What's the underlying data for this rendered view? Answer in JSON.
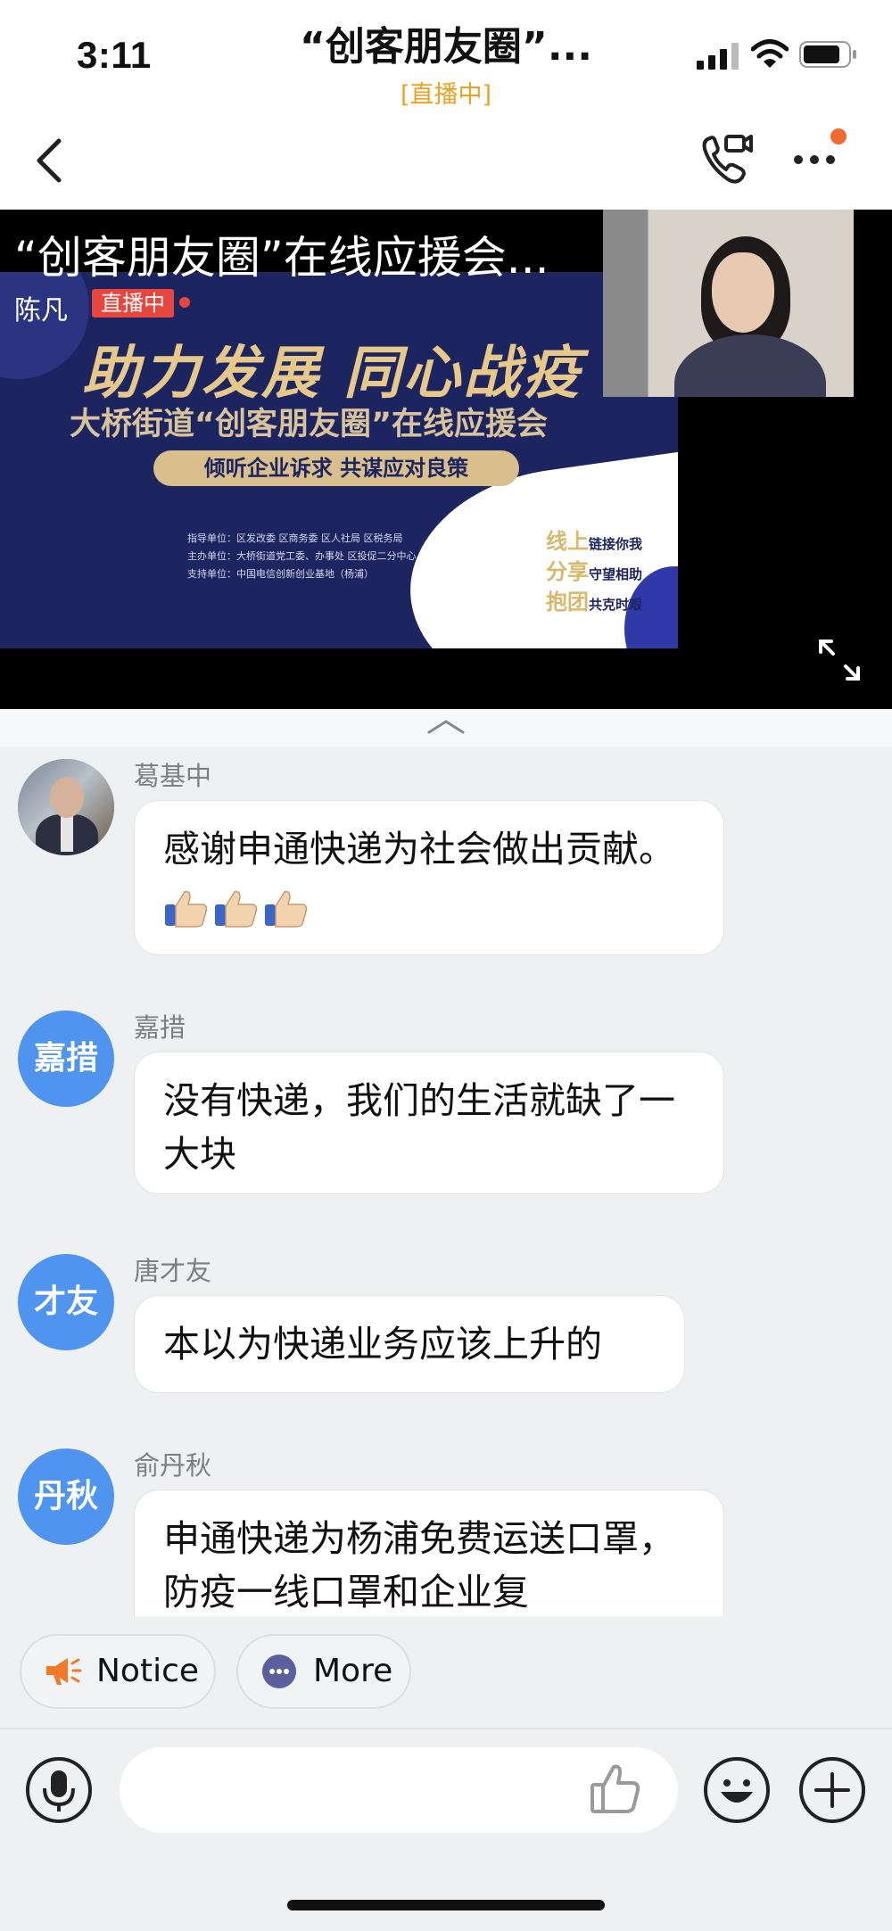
{
  "status": {
    "time": "3:11"
  },
  "header": {
    "title": "“创客朋友圈”...",
    "subtitle": "[直播中]"
  },
  "video": {
    "title": "“创客朋友圈”在线应援会...",
    "host": "陈凡",
    "live_badge": "直播中",
    "poster": {
      "headline": "助力发展  同心战疫",
      "subheadline": "大桥街道“创客朋友圈”在线应援会",
      "pill": "倾听企业诉求    共谋应对良策",
      "guide": "指导单位：区发改委  区商务委  区人社局  区税务局",
      "host_units": "主办单位：大桥街道党工委、办事处  区投促二分中心",
      "support": "支持单位：中国电信创新创业基地（杨浦）",
      "slogans": [
        {
          "big": "线上",
          "small": "链接你我"
        },
        {
          "big": "分享",
          "small": "守望相助"
        },
        {
          "big": "抱团",
          "small": "共克时艰"
        }
      ]
    }
  },
  "messages": [
    {
      "sender": "葛基中",
      "avatar_text": "",
      "text": "感谢申通快递为社会做出贡献。",
      "thumbs": 3
    },
    {
      "sender": "嘉措",
      "avatar_text": "嘉措",
      "text": "没有快递，我们的生活就缺了一大块"
    },
    {
      "sender": "唐才友",
      "avatar_text": "才友",
      "text": "本以为快递业务应该上升的"
    },
    {
      "sender": "俞丹秋",
      "avatar_text": "丹秋",
      "text": "申通快递为杨浦免费运送口罩，防疫一线口罩和企业复"
    }
  ],
  "quick_actions": {
    "notice": "Notice",
    "more": "More"
  },
  "colors": {
    "accent": "#4f94ee",
    "live_red": "#e8463c",
    "live_orange": "#f0a020",
    "notice_orange": "#f07a2a",
    "more_purple": "#5a5f9e"
  }
}
